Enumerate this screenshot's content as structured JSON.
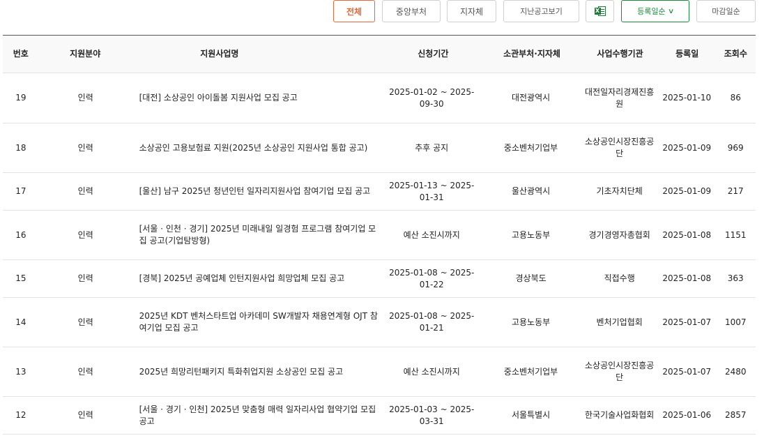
{
  "toolbar": {
    "all_label": "전체",
    "central_label": "중앙부처",
    "local_label": "지자체",
    "past_label": "지난공고보기",
    "excel_icon": "excel-icon",
    "sort_label": "등록일순",
    "deadline_label": "마감일순",
    "colors": {
      "active": "#e0683c",
      "green": "#1e8a3c"
    }
  },
  "table": {
    "headers": [
      "번호",
      "지원분야",
      "지원사업명",
      "신청기간",
      "소관부처·지자체",
      "사업수행기관",
      "등록일",
      "조회수"
    ],
    "rows": [
      {
        "no": "19",
        "field": "인력",
        "title": "[대전] 소상공인 아이돌봄 지원사업 모집 공고",
        "period": "2025-01-02 ~ 2025-09-30",
        "dept": "대전광역시",
        "org": "대전일자리경제진흥원",
        "date": "2025-01-10",
        "views": "86"
      },
      {
        "no": "18",
        "field": "인력",
        "title": "소상공인 고용보험료 지원(2025년 소상공인 지원사업 통합 공고)",
        "period": "추후 공지",
        "dept": "중소벤처기업부",
        "org": "소상공인시장진흥공단",
        "date": "2025-01-09",
        "views": "969"
      },
      {
        "no": "17",
        "field": "인력",
        "title": "[울산] 남구 2025년 청년인턴 일자리지원사업 참여기업 모집 공고",
        "period": "2025-01-13 ~ 2025-01-31",
        "dept": "울산광역시",
        "org": "기초자치단체",
        "date": "2025-01-09",
        "views": "217"
      },
      {
        "no": "16",
        "field": "인력",
        "title": "[서울 · 인천 · 경기] 2025년 미래내일 일경험 프로그램 참여기업 모집 공고(기업탐방형)",
        "period": "예산 소진시까지",
        "dept": "고용노동부",
        "org": "경기경영자총협회",
        "date": "2025-01-08",
        "views": "1151"
      },
      {
        "no": "15",
        "field": "인력",
        "title": "[경북] 2025년 공예업체 인턴지원사업 희망업체 모집 공고",
        "period": "2025-01-08 ~ 2025-01-22",
        "dept": "경상북도",
        "org": "직접수행",
        "date": "2025-01-08",
        "views": "363"
      },
      {
        "no": "14",
        "field": "인력",
        "title": "2025년 KDT 벤처스타트업 아카데미 SW개발자 채용연계형 OJT 참여기업 모집 공고",
        "period": "2025-01-08 ~ 2025-01-21",
        "dept": "고용노동부",
        "org": "벤처기업협회",
        "date": "2025-01-07",
        "views": "1007"
      },
      {
        "no": "13",
        "field": "인력",
        "title": "2025년 희망리턴패키지 특화취업지원 소상공인 모집 공고",
        "period": "예산 소진시까지",
        "dept": "중소벤처기업부",
        "org": "소상공인시장진흥공단",
        "date": "2025-01-07",
        "views": "2480"
      },
      {
        "no": "12",
        "field": "인력",
        "title": "[서울 · 경기 · 인천] 2025년 맞춤형 매력 일자리사업 협약기업 모집 공고",
        "period": "2025-01-03 ~ 2025-03-31",
        "dept": "서울특별시",
        "org": "한국기술사업화협회",
        "date": "2025-01-06",
        "views": "2857"
      }
    ]
  }
}
